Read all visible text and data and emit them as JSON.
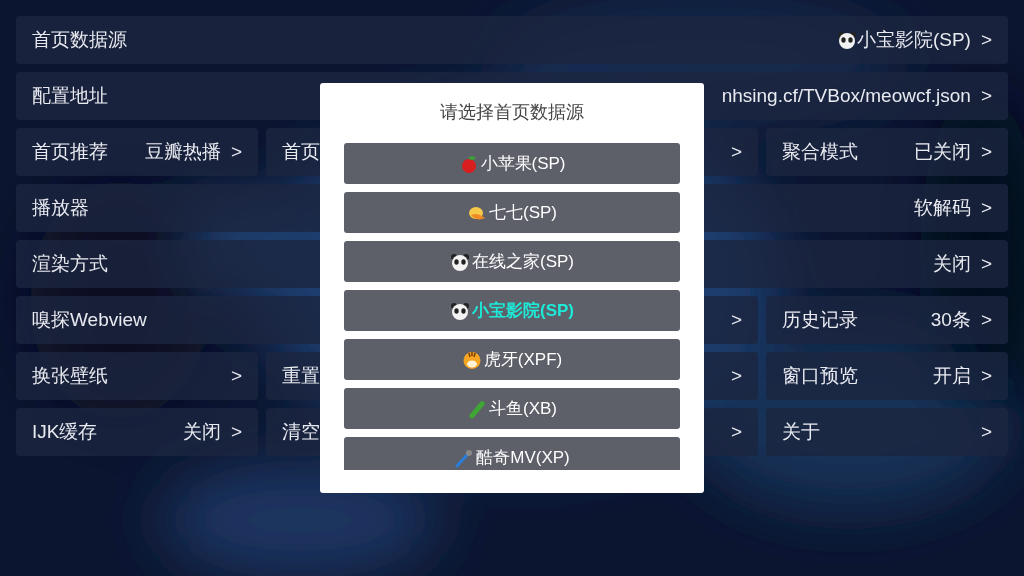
{
  "rows": [
    {
      "cells": [
        {
          "kind": "full",
          "label": "首页数据源",
          "value": {
            "kind": "panda",
            "text": "小宝影院(SP)"
          },
          "arrow": ">"
        }
      ]
    },
    {
      "cells": [
        {
          "kind": "full",
          "label": "配置地址",
          "value": "nhsing.cf/TVBox/meowcf.json",
          "arrow": ">"
        }
      ]
    },
    {
      "cells": [
        {
          "kind": "single",
          "label": "首页推荐",
          "value": "豆瓣热播",
          "arrow": ">"
        },
        {
          "kind": "double",
          "label": "首页",
          "arrow": ">"
        },
        {
          "kind": "single",
          "label": "聚合模式",
          "value": "已关闭",
          "arrow": ">"
        }
      ]
    },
    {
      "cells": [
        {
          "kind": "full",
          "label": "播放器",
          "value": "软解码",
          "arrow": ">"
        }
      ]
    },
    {
      "cells": [
        {
          "kind": "full",
          "label": "渲染方式",
          "value": "关闭",
          "arrow": ">"
        }
      ]
    },
    {
      "cells": [
        {
          "kind": "triple",
          "label": "嗅探Webview",
          "arrow": ">"
        },
        {
          "kind": "single",
          "label": "历史记录",
          "value": "30条",
          "arrow": ">"
        }
      ]
    },
    {
      "cells": [
        {
          "kind": "single",
          "label": "换张壁纸",
          "arrow": ">"
        },
        {
          "kind": "double",
          "label": "重置",
          "arrow": ">"
        },
        {
          "kind": "single",
          "label": "窗口预览",
          "value": "开启",
          "arrow": ">"
        }
      ]
    },
    {
      "cells": [
        {
          "kind": "single",
          "label": "IJK缓存",
          "value": "关闭",
          "arrow": ">"
        },
        {
          "kind": "double",
          "label": "清空",
          "arrow": ">"
        },
        {
          "kind": "single",
          "label": "关于",
          "arrow": ">"
        }
      ]
    }
  ],
  "dialog": {
    "title": "请选择首页数据源",
    "items": [
      {
        "kind": "apple",
        "label": "小苹果(SP)",
        "selected": false
      },
      {
        "kind": "hat",
        "label": "七七(SP)",
        "selected": false
      },
      {
        "kind": "panda",
        "label": "在线之家(SP)",
        "selected": false
      },
      {
        "kind": "panda",
        "label": "小宝影院(SP)",
        "selected": true
      },
      {
        "kind": "tiger",
        "label": "虎牙(XPF)",
        "selected": false
      },
      {
        "kind": "cucumber",
        "label": "斗鱼(XB)",
        "selected": false
      },
      {
        "kind": "microphone",
        "label": "酷奇MV(XP)",
        "selected": false
      }
    ]
  }
}
